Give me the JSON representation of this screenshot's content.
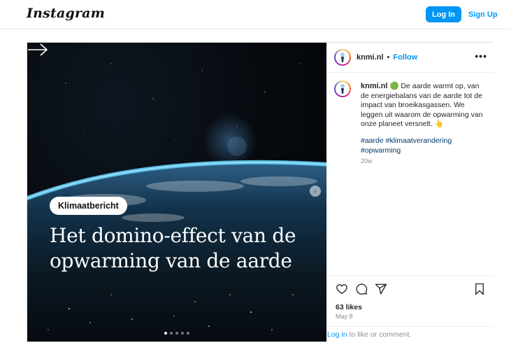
{
  "header": {
    "logo": "Instagram",
    "login_label": "Log In",
    "signup_label": "Sign Up"
  },
  "post": {
    "image": {
      "badge": "Klimaatbericht",
      "headline": "Het domino-effect van de opwarming van de aarde",
      "carousel_total": 5,
      "carousel_index": 1
    },
    "author": {
      "username": "knmi.nl",
      "separator": "•",
      "follow_label": "Follow"
    },
    "caption": {
      "username": "knmi.nl",
      "text": "🟢 De aarde warmt op, van de energiebalans van de aarde tot de impact van broeikasgassen. We leggen uit waarom de opwarming van onze planeet versnelt. 👆",
      "hashtags": "#aarde #klimaatverandering #opwarming",
      "age": "20w"
    },
    "likes": "63 likes",
    "date": "May 8",
    "login_prompt": {
      "link": "Log in",
      "text": "to like or comment."
    }
  },
  "colors": {
    "accent": "#0095f6",
    "text": "#262626",
    "muted": "#8e8e8e",
    "hashtag": "#00376b"
  },
  "icons": [
    "more-icon",
    "heart-icon",
    "comment-icon",
    "share-icon",
    "bookmark-icon",
    "next-icon",
    "arrow-right-icon"
  ]
}
